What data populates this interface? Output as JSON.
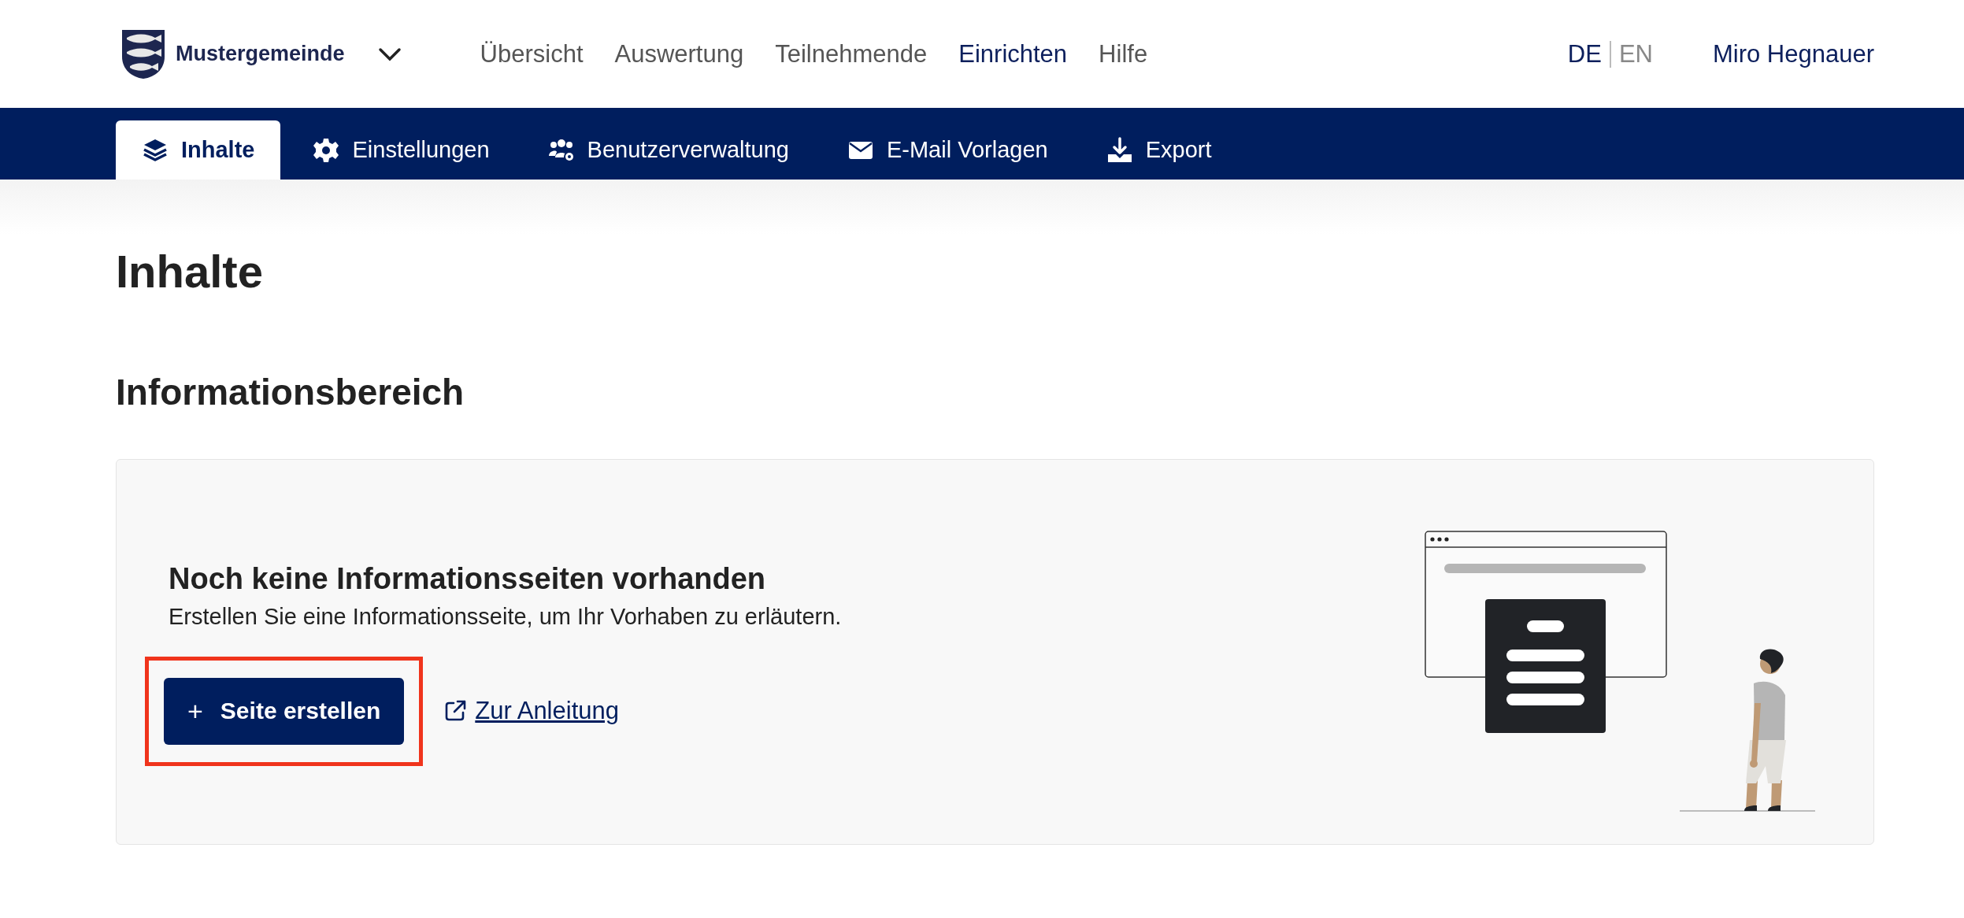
{
  "header": {
    "brand": "Mustergemeinde",
    "nav": [
      {
        "label": "Übersicht",
        "selected": false
      },
      {
        "label": "Auswertung",
        "selected": false
      },
      {
        "label": "Teilnehmende",
        "selected": false
      },
      {
        "label": "Einrichten",
        "selected": true
      },
      {
        "label": "Hilfe",
        "selected": false
      }
    ],
    "languages": [
      {
        "label": "DE",
        "selected": true
      },
      {
        "label": "EN",
        "selected": false
      }
    ],
    "user": "Miro Hegnauer"
  },
  "tabs": [
    {
      "label": "Inhalte",
      "kind": "layers",
      "selected": true
    },
    {
      "label": "Einstellungen",
      "kind": "gear",
      "selected": false
    },
    {
      "label": "Benutzerverwaltung",
      "kind": "users",
      "selected": false
    },
    {
      "label": "E-Mail Vorlagen",
      "kind": "envelope",
      "selected": false
    },
    {
      "label": "Export",
      "kind": "download",
      "selected": false
    }
  ],
  "page_title": "Inhalte",
  "section_title": "Informationsbereich",
  "empty_state": {
    "title": "Noch keine Informationsseiten vorhanden",
    "text": "Erstellen Sie eine Informationsseite, um Ihr Vorhaben zu erläutern.",
    "button": {
      "icon": "+",
      "label": "Seite erstellen",
      "highlighted": true
    },
    "link": "Zur Anleitung"
  }
}
